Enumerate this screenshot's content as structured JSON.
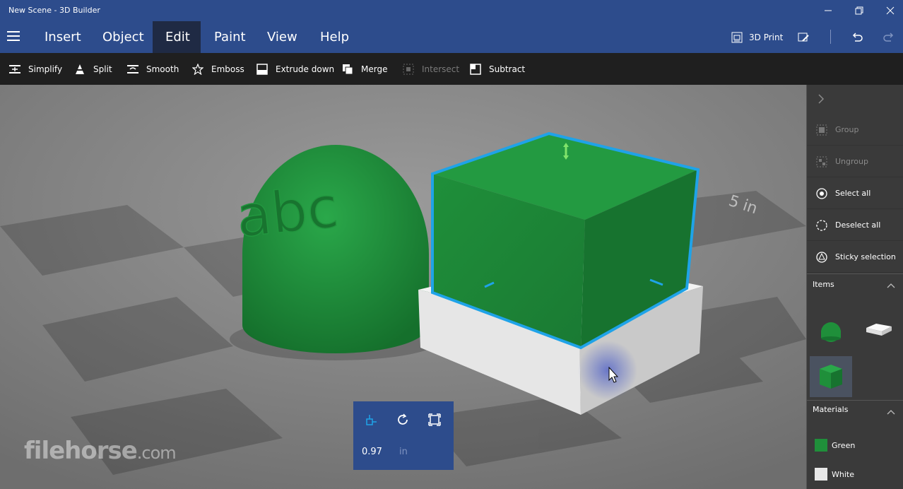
{
  "window": {
    "title": "New Scene - 3D Builder",
    "controls": [
      "minimize-icon",
      "restore-icon",
      "close-icon"
    ]
  },
  "menu": {
    "items": [
      {
        "label": "Insert"
      },
      {
        "label": "Object"
      },
      {
        "label": "Edit",
        "active": true
      },
      {
        "label": "Paint"
      },
      {
        "label": "View"
      },
      {
        "label": "Help"
      }
    ],
    "print_label": "3D Print"
  },
  "toolbar": {
    "tools": [
      {
        "label": "Simplify",
        "icon": "simplify-icon",
        "enabled": true
      },
      {
        "label": "Split",
        "icon": "split-icon",
        "enabled": true
      },
      {
        "label": "Smooth",
        "icon": "smooth-icon",
        "enabled": true
      },
      {
        "label": "Emboss",
        "icon": "star-icon",
        "enabled": true
      },
      {
        "label": "Extrude down",
        "icon": "extrude-icon",
        "enabled": true
      },
      {
        "label": "Merge",
        "icon": "merge-icon",
        "enabled": true
      },
      {
        "label": "Intersect",
        "icon": "intersect-icon",
        "enabled": false
      },
      {
        "label": "Subtract",
        "icon": "subtract-icon",
        "enabled": true
      }
    ]
  },
  "scene": {
    "dome_text": "abc",
    "floor_label": "5 in"
  },
  "sidepanel": {
    "actions": [
      {
        "label": "Group",
        "enabled": false
      },
      {
        "label": "Ungroup",
        "enabled": false
      },
      {
        "label": "Select all",
        "enabled": true
      },
      {
        "label": "Deselect all",
        "enabled": true
      },
      {
        "label": "Sticky selection",
        "enabled": true
      }
    ],
    "items_header": "Items",
    "materials_header": "Materials",
    "materials": [
      {
        "label": "Green",
        "color": "#1f8f3a"
      },
      {
        "label": "White",
        "color": "#e8e8e8"
      }
    ]
  },
  "transform": {
    "value": "0.97",
    "unit": "in"
  },
  "watermark": {
    "brand": "filehorse",
    "suffix": ".com"
  },
  "colors": {
    "accent": "#2d4c8c",
    "selection": "#1fa3e8",
    "object_green": "#1f8f3a"
  }
}
